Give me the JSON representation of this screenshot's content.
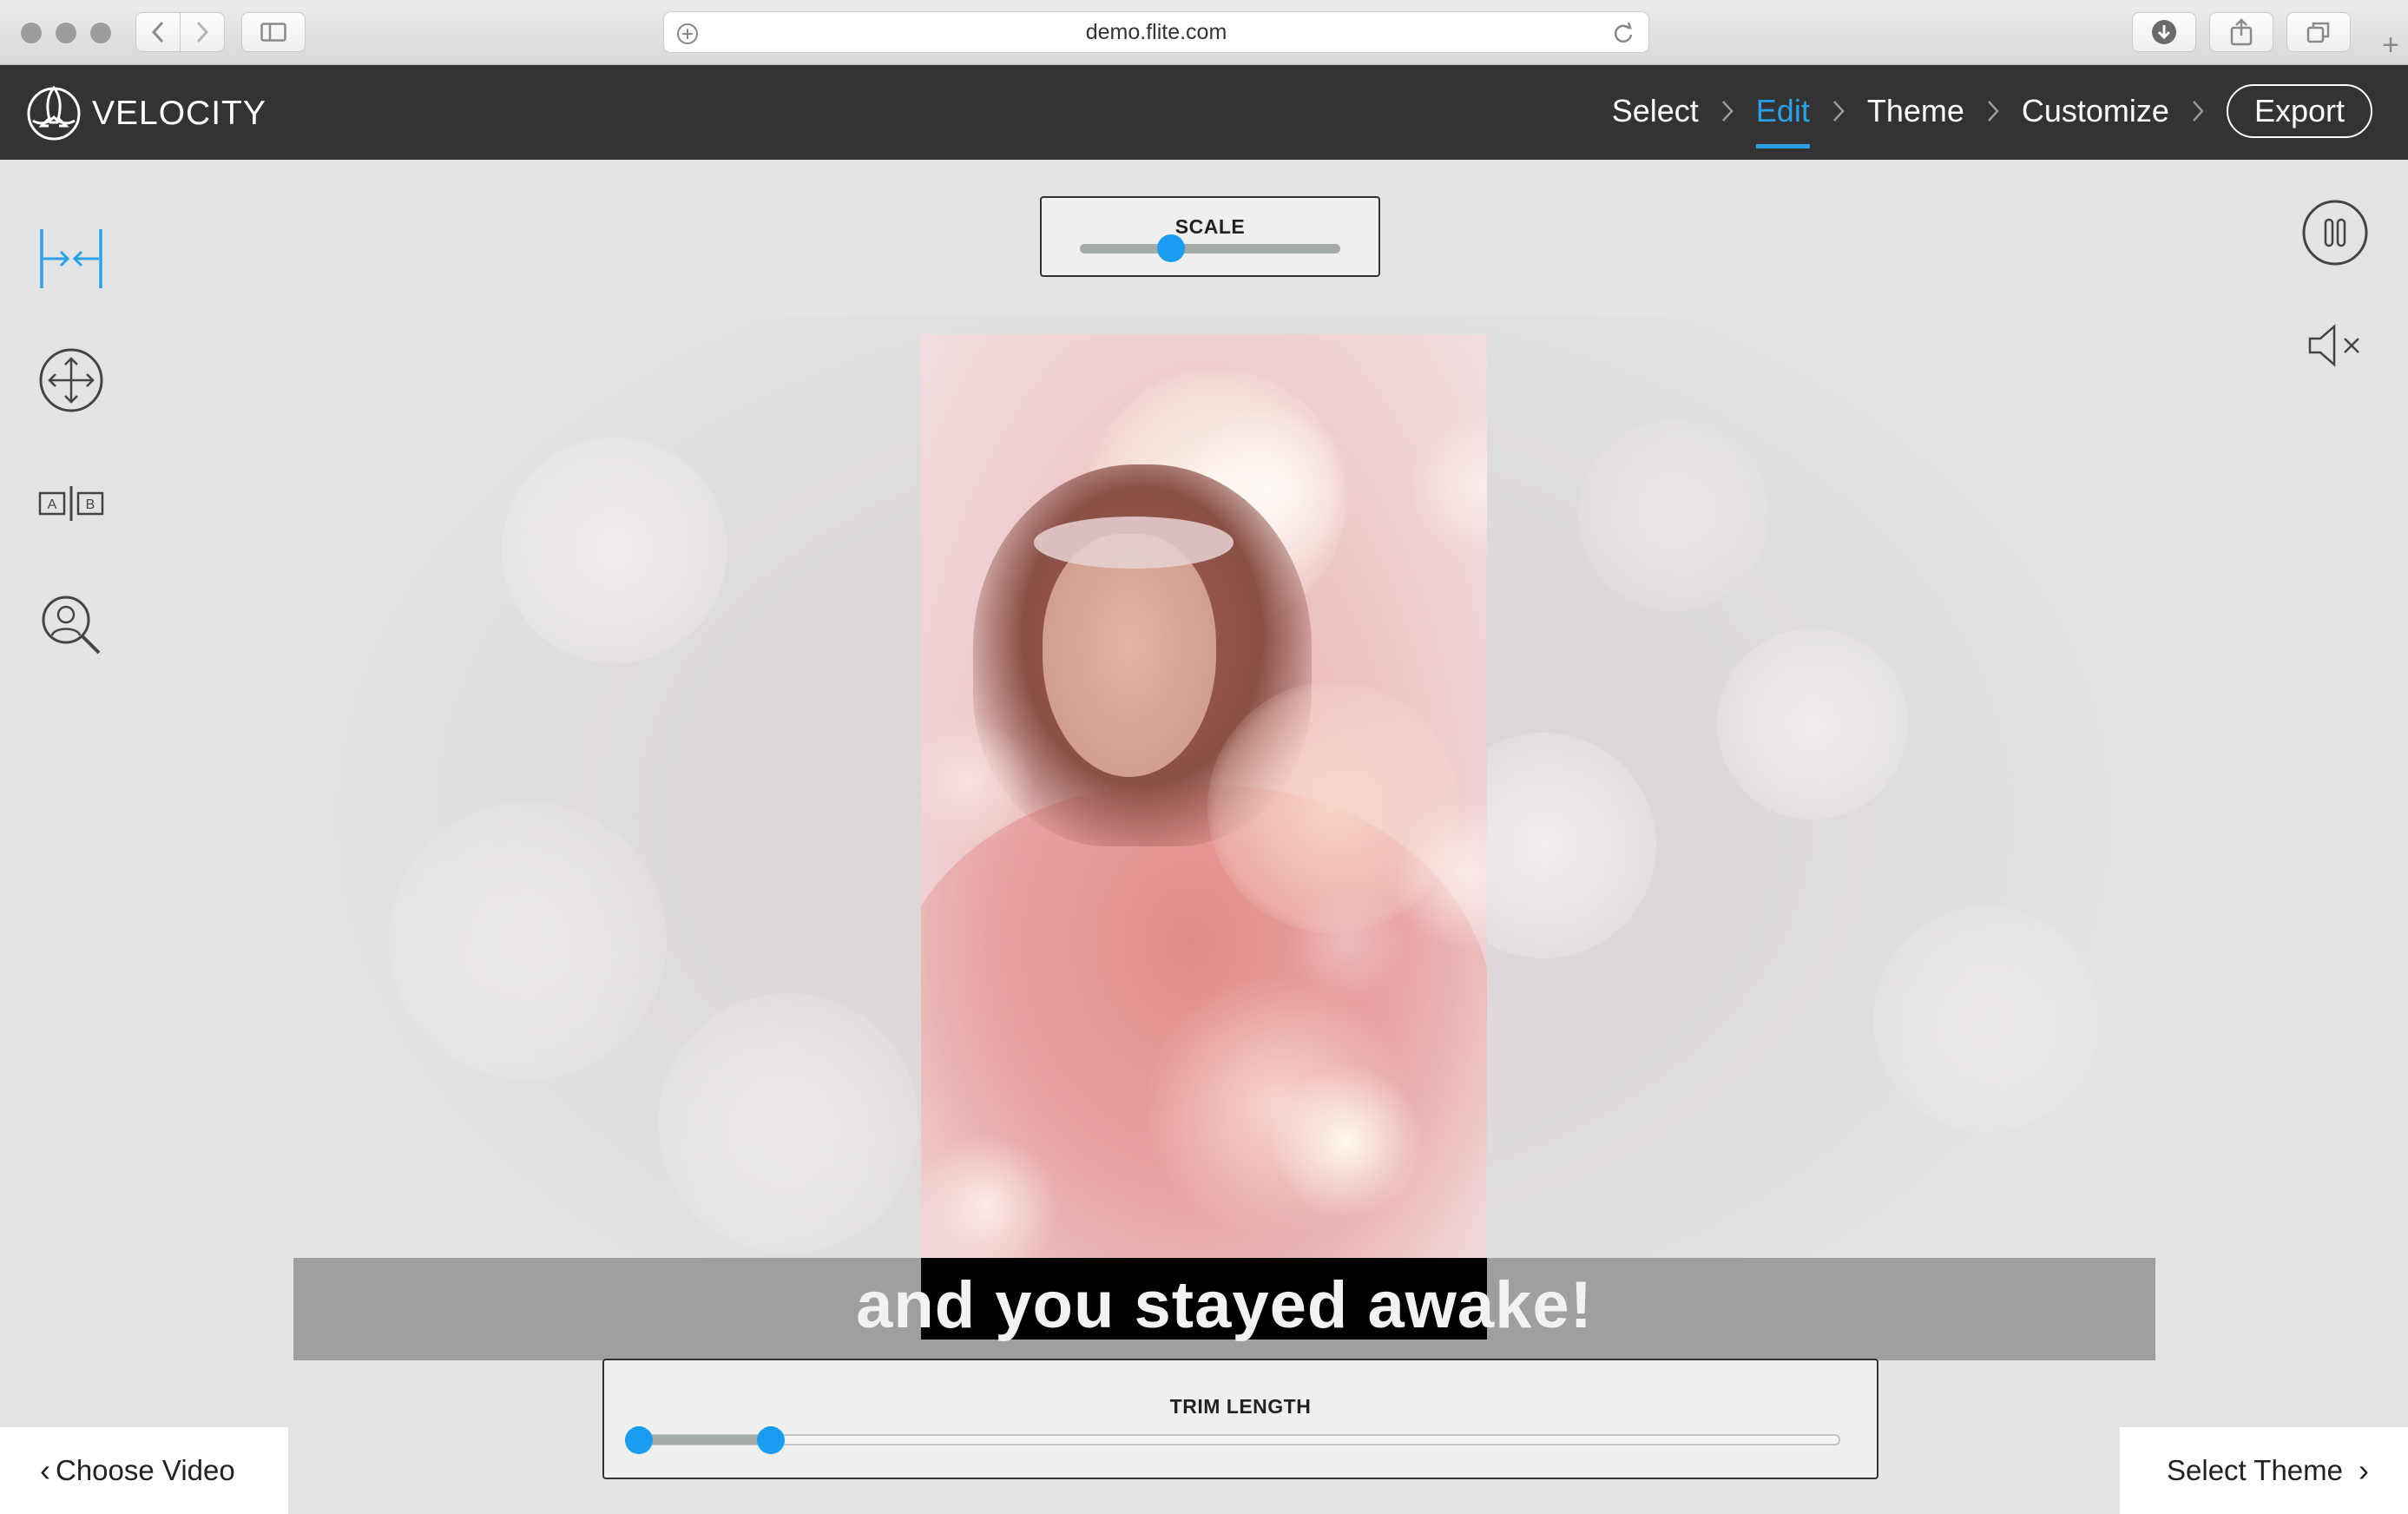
{
  "browser": {
    "url": "demo.flite.com",
    "new_tab_glyph": "+"
  },
  "app": {
    "brand": "VELOCITY",
    "logo_icon": "velocity-rocket-logo-icon",
    "steps": [
      {
        "label": "Select",
        "active": false
      },
      {
        "label": "Edit",
        "active": true
      },
      {
        "label": "Theme",
        "active": false
      },
      {
        "label": "Customize",
        "active": false
      }
    ],
    "export_label": "Export",
    "accent_color": "#2aa3e6",
    "header_color": "#333333"
  },
  "tools": [
    {
      "name": "fit-width-tool-icon",
      "active": true
    },
    {
      "name": "move-tool-icon",
      "active": false
    },
    {
      "name": "ab-split-tool-icon",
      "active": false
    },
    {
      "name": "face-zoom-tool-icon",
      "active": false
    }
  ],
  "scale": {
    "label": "SCALE",
    "value_fraction": 0.35
  },
  "player": {
    "pause_icon": "pause-icon",
    "mute_icon": "speaker-muted-icon"
  },
  "caption": {
    "text": "and you stayed awake!"
  },
  "trim": {
    "label": "TRIM LENGTH",
    "start_fraction": 0.0,
    "end_fraction": 0.097
  },
  "nav": {
    "back_label": "Choose Video",
    "back_glyph": "‹",
    "next_label": "Select Theme",
    "next_glyph": "›"
  }
}
